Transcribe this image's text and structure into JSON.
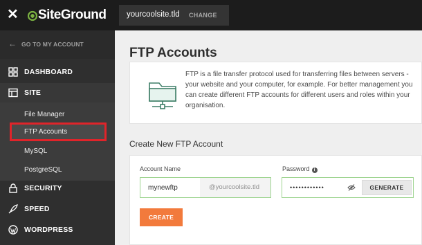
{
  "topbar": {
    "brand": "SiteGround",
    "site_name": "yourcoolsite.tld",
    "change_label": "CHANGE"
  },
  "sidebar": {
    "back_label": "GO TO MY ACCOUNT",
    "items": [
      {
        "label": "DASHBOARD",
        "icon": "dashboard-icon"
      },
      {
        "label": "SITE",
        "icon": "site-icon"
      },
      {
        "label": "SECURITY",
        "icon": "lock-icon"
      },
      {
        "label": "SPEED",
        "icon": "rocket-icon"
      },
      {
        "label": "WORDPRESS",
        "icon": "wordpress-icon"
      }
    ],
    "subitems": [
      {
        "label": "File Manager"
      },
      {
        "label": "FTP Accounts",
        "active": true
      },
      {
        "label": "MySQL"
      },
      {
        "label": "PostgreSQL"
      }
    ]
  },
  "main": {
    "title": "FTP Accounts",
    "info_text": "FTP is a file transfer protocol used for transferring files between servers - your website and your computer, for example. For better management you can create different FTP accounts for different users and roles within your organisation.",
    "section_title": "Create New FTP Account",
    "form": {
      "account_label": "Account Name",
      "account_value": "mynewftp",
      "account_suffix": "@yourcoolsite.tld",
      "password_label": "Password",
      "password_value": "••••••••••••",
      "generate_label": "GENERATE",
      "create_label": "CREATE"
    }
  },
  "colors": {
    "accent": "#f27a3c",
    "highlight": "#e0242a",
    "valid_border": "#9dd48f",
    "brand_green": "#7cb342",
    "topbar": "#1c1c1c",
    "sidebar": "#2f2f2f"
  }
}
